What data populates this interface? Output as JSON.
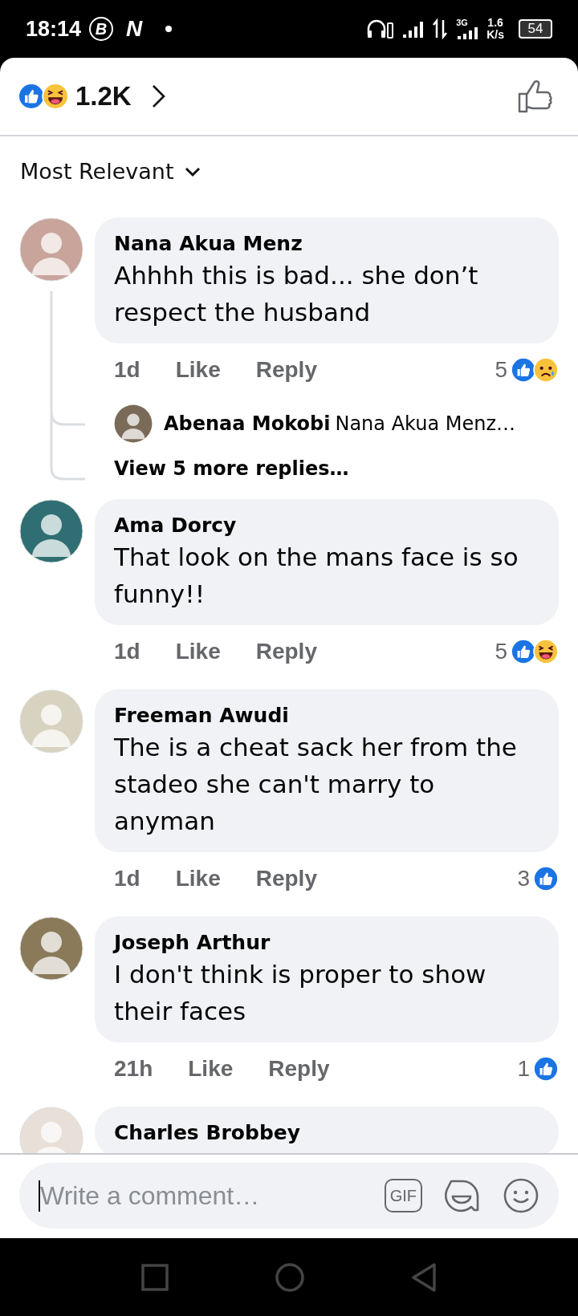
{
  "status_bar": {
    "time": "18:14",
    "notifications": [
      "B",
      "N"
    ],
    "network_type": "3G",
    "speed": "1.6",
    "speed_unit": "K/s",
    "battery": "54"
  },
  "header": {
    "reactions": [
      {
        "kind": "like"
      },
      {
        "kind": "haha"
      }
    ],
    "reaction_count": "1.2K"
  },
  "sort": {
    "label": "Most Relevant"
  },
  "comments": [
    {
      "author": "Nana Akua Menz",
      "text": "Ahhhh this is bad... she don’t respect the husband",
      "time": "1d",
      "like_label": "Like",
      "reply_label": "Reply",
      "reaction_count": "5",
      "reactions": [
        {
          "kind": "like"
        },
        {
          "kind": "sad"
        }
      ],
      "replies": {
        "preview_author": "Abenaa Mokobi",
        "preview_text": "Nana Akua Menz…",
        "more_label": "View 5 more replies…"
      }
    },
    {
      "author": "Ama Dorcy",
      "text": "That look on the mans face is so funny!!",
      "time": "1d",
      "like_label": "Like",
      "reply_label": "Reply",
      "reaction_count": "5",
      "reactions": [
        {
          "kind": "like"
        },
        {
          "kind": "haha"
        }
      ]
    },
    {
      "author": "Freeman Awudi",
      "text": "The is a cheat sack her from the stadeo she can't marry to anyman",
      "time": "1d",
      "like_label": "Like",
      "reply_label": "Reply",
      "reaction_count": "3",
      "reactions": [
        {
          "kind": "like"
        }
      ]
    },
    {
      "author": "Joseph Arthur",
      "text": "I don't think is proper to show their faces",
      "time": "21h",
      "like_label": "Like",
      "reply_label": "Reply",
      "reaction_count": "1",
      "reactions": [
        {
          "kind": "like"
        }
      ]
    },
    {
      "author": "Charles Brobbey"
    }
  ],
  "composer": {
    "placeholder": "Write a comment…",
    "gif_label": "GIF"
  }
}
